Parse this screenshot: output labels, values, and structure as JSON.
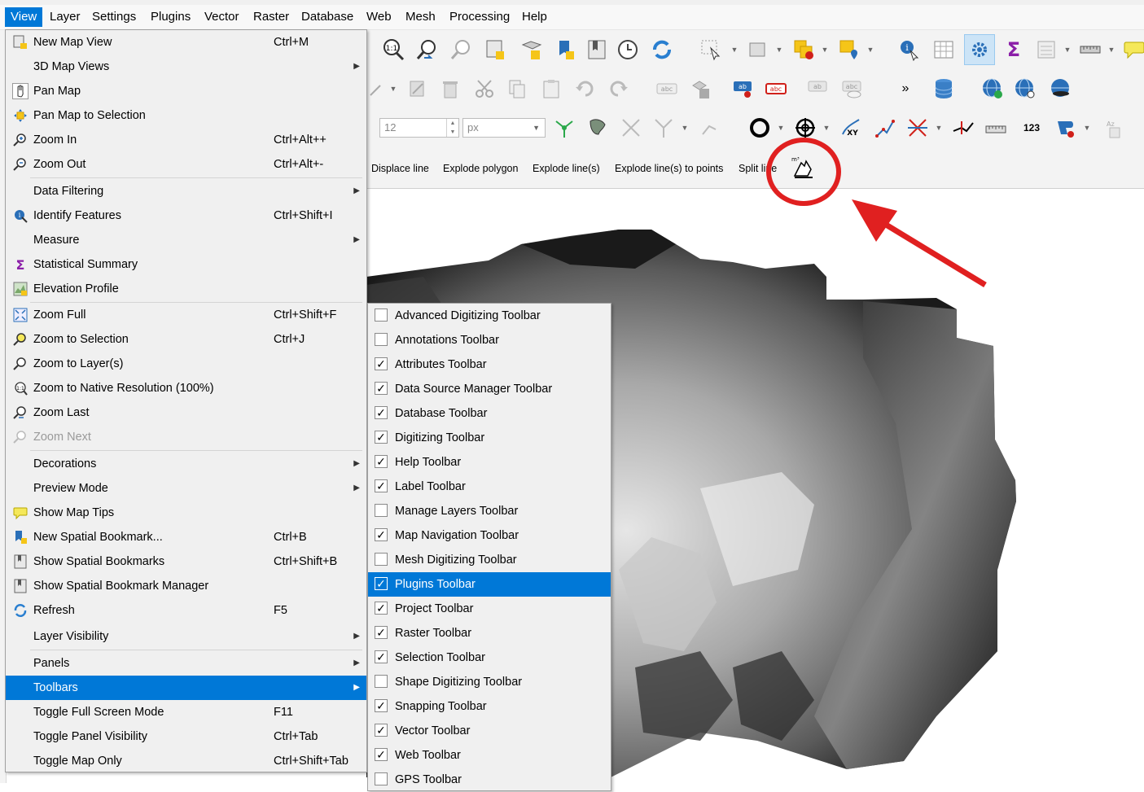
{
  "menubar": {
    "items": [
      "View",
      "Layer",
      "Settings",
      "Plugins",
      "Vector",
      "Raster",
      "Database",
      "Web",
      "Mesh",
      "Processing",
      "Help"
    ],
    "active": "View"
  },
  "toolbar": {
    "size_value": "12",
    "size_unit": "px",
    "overflow_glyph": "»",
    "label_number_glyph": "123",
    "text_actions": [
      "Displace line",
      "Explode polygon",
      "Explode line(s)",
      "Explode line(s) to points",
      "Split line"
    ]
  },
  "view_menu": {
    "items": [
      {
        "label": "New Map View",
        "shortcut": "Ctrl+M",
        "icon": "new-map-view-icon"
      },
      {
        "label": "3D Map Views",
        "submenu": true
      },
      {
        "label": "Pan Map",
        "icon": "pan-hand-icon"
      },
      {
        "label": "Pan Map to Selection",
        "icon": "pan-to-selection-icon"
      },
      {
        "label": "Zoom In",
        "shortcut": "Ctrl+Alt++",
        "icon": "zoom-in-icon"
      },
      {
        "label": "Zoom Out",
        "shortcut": "Ctrl+Alt+-",
        "icon": "zoom-out-icon"
      },
      {
        "label": "Data Filtering",
        "submenu": true
      },
      {
        "label": "Identify Features",
        "shortcut": "Ctrl+Shift+I",
        "icon": "identify-icon"
      },
      {
        "label": "Measure",
        "submenu": true
      },
      {
        "label": "Statistical Summary",
        "icon": "sigma-icon"
      },
      {
        "label": "Elevation Profile",
        "icon": "elevation-profile-icon"
      },
      {
        "label": "Zoom Full",
        "shortcut": "Ctrl+Shift+F",
        "icon": "zoom-full-icon"
      },
      {
        "label": "Zoom to Selection",
        "shortcut": "Ctrl+J",
        "icon": "zoom-selection-icon"
      },
      {
        "label": "Zoom to Layer(s)",
        "icon": "zoom-layer-icon"
      },
      {
        "label": "Zoom to Native Resolution (100%)",
        "icon": "zoom-native-icon"
      },
      {
        "label": "Zoom Last",
        "icon": "zoom-last-icon"
      },
      {
        "label": "Zoom Next",
        "icon": "zoom-next-icon",
        "disabled": true
      },
      {
        "label": "Decorations",
        "submenu": true
      },
      {
        "label": "Preview Mode",
        "submenu": true
      },
      {
        "label": "Show Map Tips",
        "icon": "map-tips-icon"
      },
      {
        "label": "New Spatial Bookmark...",
        "shortcut": "Ctrl+B",
        "icon": "new-bookmark-icon"
      },
      {
        "label": "Show Spatial Bookmarks",
        "shortcut": "Ctrl+Shift+B",
        "icon": "bookmarks-icon"
      },
      {
        "label": "Show Spatial Bookmark Manager",
        "icon": "bookmark-manager-icon"
      },
      {
        "label": "Refresh",
        "shortcut": "F5",
        "icon": "refresh-icon"
      },
      {
        "label": "Layer Visibility",
        "submenu": true
      },
      {
        "label": "Panels",
        "submenu": true
      },
      {
        "label": "Toolbars",
        "submenu": true,
        "highlighted": true
      },
      {
        "label": "Toggle Full Screen Mode",
        "shortcut": "F11"
      },
      {
        "label": "Toggle Panel Visibility",
        "shortcut": "Ctrl+Tab"
      },
      {
        "label": "Toggle Map Only",
        "shortcut": "Ctrl+Shift+Tab"
      }
    ]
  },
  "toolbars_submenu": {
    "items": [
      {
        "label": "Advanced Digitizing Toolbar",
        "checked": false
      },
      {
        "label": "Annotations Toolbar",
        "checked": false
      },
      {
        "label": "Attributes Toolbar",
        "checked": true
      },
      {
        "label": "Data Source Manager Toolbar",
        "checked": true
      },
      {
        "label": "Database Toolbar",
        "checked": true
      },
      {
        "label": "Digitizing Toolbar",
        "checked": true
      },
      {
        "label": "Help Toolbar",
        "checked": true
      },
      {
        "label": "Label Toolbar",
        "checked": true
      },
      {
        "label": "Manage Layers Toolbar",
        "checked": false
      },
      {
        "label": "Map Navigation Toolbar",
        "checked": true
      },
      {
        "label": "Mesh Digitizing Toolbar",
        "checked": false
      },
      {
        "label": "Plugins Toolbar",
        "checked": true,
        "highlighted": true
      },
      {
        "label": "Project Toolbar",
        "checked": true
      },
      {
        "label": "Raster Toolbar",
        "checked": true
      },
      {
        "label": "Selection Toolbar",
        "checked": true
      },
      {
        "label": "Shape Digitizing Toolbar",
        "checked": false
      },
      {
        "label": "Snapping Toolbar",
        "checked": true
      },
      {
        "label": "Vector Toolbar",
        "checked": true
      },
      {
        "label": "Web Toolbar",
        "checked": true
      },
      {
        "label": "GPS Toolbar",
        "checked": false
      }
    ]
  },
  "annotation": {
    "color": "#e02020"
  },
  "colors": {
    "highlight": "#0078d7",
    "menu_bg": "#f0f0f0",
    "toolbar_bg": "#f3f3f3"
  }
}
